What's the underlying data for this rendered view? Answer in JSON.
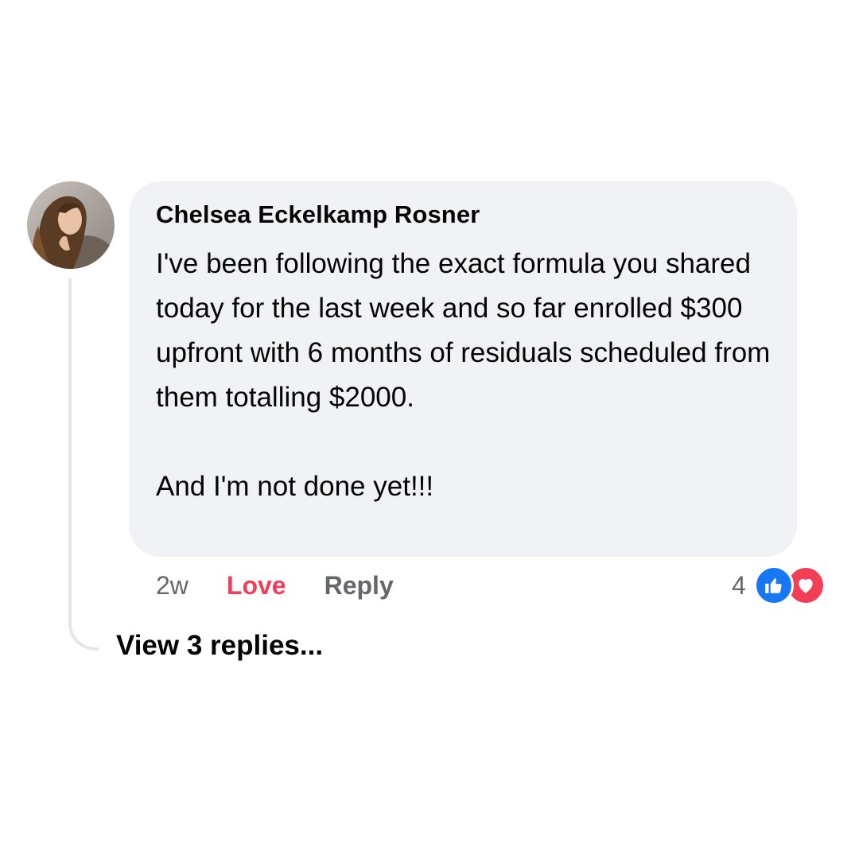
{
  "comment": {
    "author": "Chelsea Eckelkamp Rosner",
    "text": "I've been following the exact formula you shared today for the last week and so far enrolled $300 upfront with 6 months of residuals scheduled from them totalling $2000.\n\nAnd I'm not done yet!!!",
    "timestamp": "2w",
    "love_label": "Love",
    "reply_label": "Reply",
    "reaction_count": "4",
    "reactions": [
      "like-icon",
      "love-icon"
    ]
  },
  "replies": {
    "label": "View 3 replies..."
  },
  "colors": {
    "bubble": "#f0f2f5",
    "love": "#f33e58",
    "like": "#1877f2",
    "secondary_text": "#65676b",
    "thread_line": "#e4e6eb"
  }
}
